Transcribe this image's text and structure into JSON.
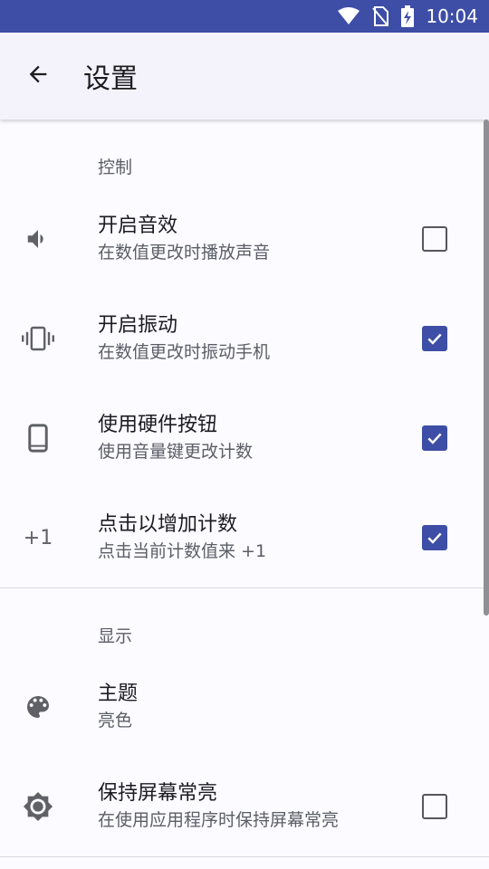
{
  "status_bar": {
    "time": "10:04",
    "icons": [
      "wifi-icon",
      "no-sim-icon",
      "battery-charging-icon"
    ],
    "background": "#3e4ea6"
  },
  "app_bar": {
    "title": "设置",
    "back_icon": "arrow-back-icon"
  },
  "sections": {
    "control": {
      "header": "控制",
      "items": [
        {
          "title": "开启音效",
          "summary": "在数值更改时播放声音",
          "icon": "volume-icon",
          "checked": false
        },
        {
          "title": "开启振动",
          "summary": "在数值更改时振动手机",
          "icon": "vibration-icon",
          "checked": true
        },
        {
          "title": "使用硬件按钮",
          "summary": "使用音量键更改计数",
          "icon": "phone-icon",
          "checked": true
        },
        {
          "title": "点击以增加计数",
          "summary": "点击当前计数值来 +1",
          "icon_text": "+1",
          "checked": true
        }
      ]
    },
    "display": {
      "header": "显示",
      "items": [
        {
          "title": "主题",
          "summary": "亮色",
          "icon": "palette-icon"
        },
        {
          "title": "保持屏幕常亮",
          "summary": "在使用应用程序时保持屏幕常亮",
          "icon": "brightness-icon",
          "checked": false
        }
      ]
    }
  },
  "colors": {
    "accent": "#3e4ea6"
  }
}
